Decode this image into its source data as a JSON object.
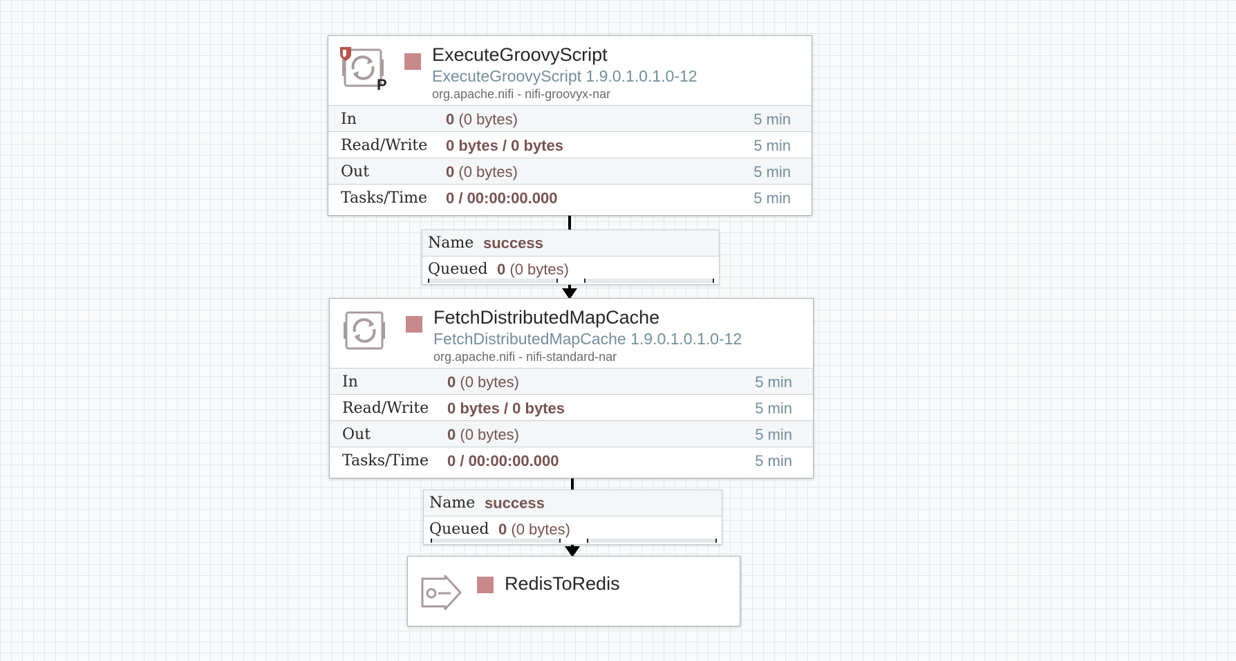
{
  "colors": {
    "canvas_background": "#f9fafb",
    "grid_line": "#e3e8eb",
    "stopped_indicator": "#c7898a",
    "value_text": "#775351",
    "muted_text": "#728e9b"
  },
  "processors": [
    {
      "name": "ExecuteGroovyScript",
      "type": "ExecuteGroovyScript 1.9.0.1.0.1.0-12",
      "bundle": "org.apache.nifi - nifi-groovyx-nar",
      "icon": "processor-icon",
      "run_state": "stopped",
      "restricted_badge": "restricted-shield-icon",
      "primary_badge": "P",
      "stats": {
        "in": {
          "label": "In",
          "count": "0",
          "detail": "(0 bytes)",
          "window": "5 min"
        },
        "read_write": {
          "label": "Read/Write",
          "value": "0 bytes / 0 bytes",
          "window": "5 min"
        },
        "out": {
          "label": "Out",
          "count": "0",
          "detail": "(0 bytes)",
          "window": "5 min"
        },
        "tasks_time": {
          "label": "Tasks/Time",
          "value": "0 / 00:00:00.000",
          "window": "5 min"
        }
      }
    },
    {
      "name": "FetchDistributedMapCache",
      "type": "FetchDistributedMapCache 1.9.0.1.0.1.0-12",
      "bundle": "org.apache.nifi - nifi-standard-nar",
      "icon": "processor-icon",
      "run_state": "stopped",
      "stats": {
        "in": {
          "label": "In",
          "count": "0",
          "detail": "(0 bytes)",
          "window": "5 min"
        },
        "read_write": {
          "label": "Read/Write",
          "value": "0 bytes / 0 bytes",
          "window": "5 min"
        },
        "out": {
          "label": "Out",
          "count": "0",
          "detail": "(0 bytes)",
          "window": "5 min"
        },
        "tasks_time": {
          "label": "Tasks/Time",
          "value": "0 / 00:00:00.000",
          "window": "5 min"
        }
      }
    }
  ],
  "connections": [
    {
      "name_label": "Name",
      "name": "success",
      "queued_label": "Queued",
      "queued_count": "0",
      "queued_detail": "(0 bytes)"
    },
    {
      "name_label": "Name",
      "name": "success",
      "queued_label": "Queued",
      "queued_count": "0",
      "queued_detail": "(0 bytes)"
    }
  ],
  "output_port": {
    "name": "RedisToRedis",
    "icon": "output-port-icon",
    "run_state": "stopped"
  }
}
